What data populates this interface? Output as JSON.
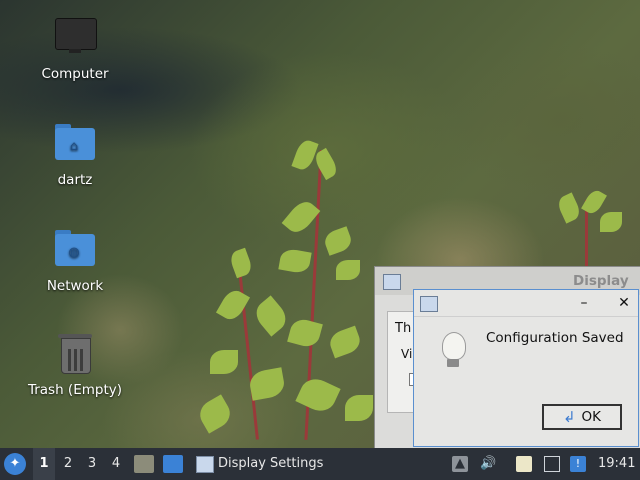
{
  "desktop": {
    "icons": [
      {
        "label": "Computer",
        "icon": "computer-icon"
      },
      {
        "label": "dartz",
        "icon": "home-folder-icon"
      },
      {
        "label": "Network",
        "icon": "network-folder-icon"
      },
      {
        "label": "Trash (Empty)",
        "icon": "trash-icon"
      }
    ]
  },
  "background_window": {
    "title": "Display",
    "text_1": "Th",
    "text_2": "Vi"
  },
  "dialog": {
    "message": "Configuration Saved",
    "minimize_glyph": "–",
    "close_glyph": "✕",
    "ok_label": "OK",
    "icon": "lightbulb-icon"
  },
  "taskbar": {
    "workspaces": [
      "1",
      "2",
      "3",
      "4"
    ],
    "active_workspace": "1",
    "task_title": "Display Settings",
    "clock": "19:41"
  },
  "colors": {
    "taskbar": "#2b3038",
    "dialog_border": "#5a8fcf",
    "folder": "#4a90d9",
    "start_button": "#3b82d6"
  }
}
